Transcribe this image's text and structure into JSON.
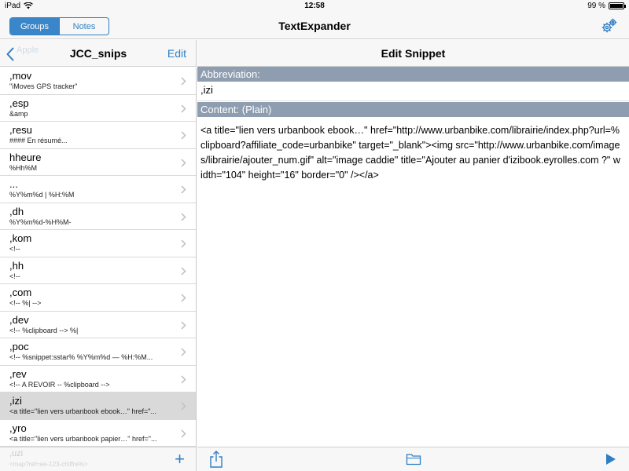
{
  "status_bar": {
    "device": "iPad",
    "time": "12:58",
    "battery_text": "99 %",
    "battery_level": 0.99
  },
  "nav": {
    "tabs": [
      {
        "label": "Groups",
        "active": true
      },
      {
        "label": "Notes",
        "active": false
      }
    ],
    "title": "TextExpander",
    "settings_icon": "gears-icon"
  },
  "left_pane": {
    "back_ghost_label": "Apple",
    "title": "JCC_snips",
    "edit_label": "Edit",
    "snippets": [
      {
        "abbr": ",mov",
        "preview": "\"iMoves GPS tracker\"",
        "selected": false
      },
      {
        "abbr": ",esp",
        "preview": "&amp",
        "selected": false
      },
      {
        "abbr": ",resu",
        "preview": "#### En résumé...",
        "selected": false
      },
      {
        "abbr": "hheure",
        "preview": "%Hh%M",
        "selected": false
      },
      {
        "abbr": "...",
        "preview": "%Y%m%d | %H:%M",
        "selected": false
      },
      {
        "abbr": ",dh",
        "preview": "%Y%m%d-%H%M-",
        "selected": false
      },
      {
        "abbr": ",kom",
        "preview": "<!--",
        "selected": false
      },
      {
        "abbr": ",hh",
        "preview": "<!--",
        "selected": false
      },
      {
        "abbr": ",com",
        "preview": "<!-- %| -->",
        "selected": false
      },
      {
        "abbr": ",dev",
        "preview": "<!-- %clipboard --> %|",
        "selected": false
      },
      {
        "abbr": ",poc",
        "preview": "<!-- %snippet:sstar% %Y%m%d — %H:%M...",
        "selected": false
      },
      {
        "abbr": ",rev",
        "preview": "<!-- A REVOIR -- %clipboard -->",
        "selected": true
      },
      {
        "abbr": ",izi",
        "preview": "<a title=\"lien vers urbanbook ebook…\" href=\"...",
        "selected": true
      },
      {
        "abbr": ",yro",
        "preview": "<a title=\"lien vers urbanbook papier…\" href=\"...",
        "selected": false
      }
    ],
    "footer_ghost_abbr": ",uzi",
    "footer_ghost_preview": "<map?ref=ee-123-chiffre%>",
    "add_label": "+"
  },
  "right_pane": {
    "title": "Edit Snippet",
    "abbreviation_header": "Abbreviation:",
    "abbreviation_value": ",izi",
    "content_header": "Content: (Plain)",
    "content_value": "<a title=\"lien vers urbanbook ebook…\" href=\"http://www.urbanbike.com/librairie/index.php?url=%clipboard?affiliate_code=urbanbike\" target=\"_blank\"><img src=\"http://www.urbanbike.com/images/librairie/ajouter_num.gif\" alt=\"image caddie\" title=\"Ajouter au panier d'izibook.eyrolles.com ?\" width=\"104\" height=\"16\" border=\"0\" /></a>"
  },
  "colors": {
    "accent": "#2f7fc4",
    "section_header": "#8e9db0",
    "selected_row": "#d9d9d9",
    "bar_background": "#f7f7f7"
  }
}
